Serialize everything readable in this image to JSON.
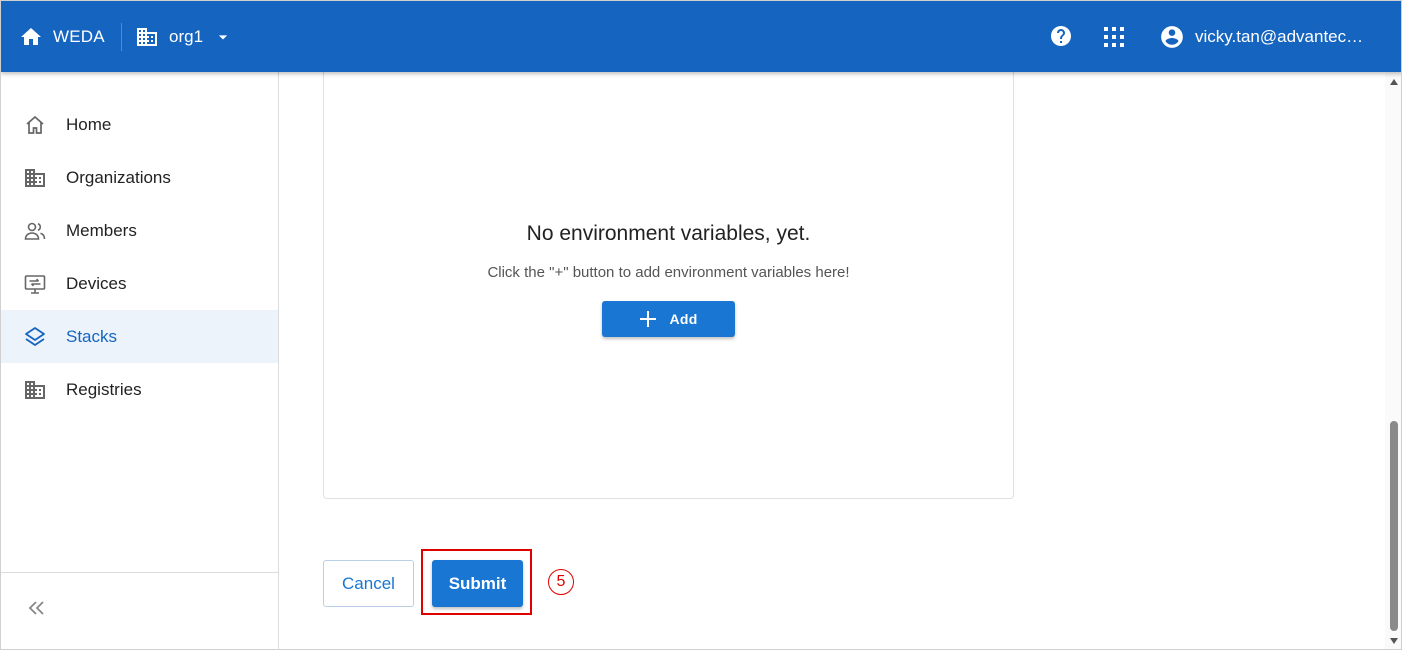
{
  "header": {
    "app_name": "WEDA",
    "org_name": "org1",
    "user_email": "vicky.tan@advantec…"
  },
  "sidebar": {
    "items": [
      {
        "label": "Home",
        "icon": "home-outline-icon",
        "active": false
      },
      {
        "label": "Organizations",
        "icon": "building-icon",
        "active": false
      },
      {
        "label": "Members",
        "icon": "people-icon",
        "active": false
      },
      {
        "label": "Devices",
        "icon": "device-icon",
        "active": false
      },
      {
        "label": "Stacks",
        "icon": "layers-icon",
        "active": true
      },
      {
        "label": "Registries",
        "icon": "building-icon",
        "active": false
      }
    ],
    "collapse_icon": "double-chevron-left-icon"
  },
  "env_vars": {
    "empty_title": "No environment variables, yet.",
    "empty_hint": "Click the \"+\" button to add environment variables here!",
    "add_label": "Add"
  },
  "form_actions": {
    "cancel_label": "Cancel",
    "submit_label": "Submit"
  },
  "annotation": {
    "step_number": "5"
  },
  "colors": {
    "primary": "#1565c0",
    "button": "#1976d2",
    "active_bg": "#edf3fb",
    "highlight": "#e00000"
  }
}
